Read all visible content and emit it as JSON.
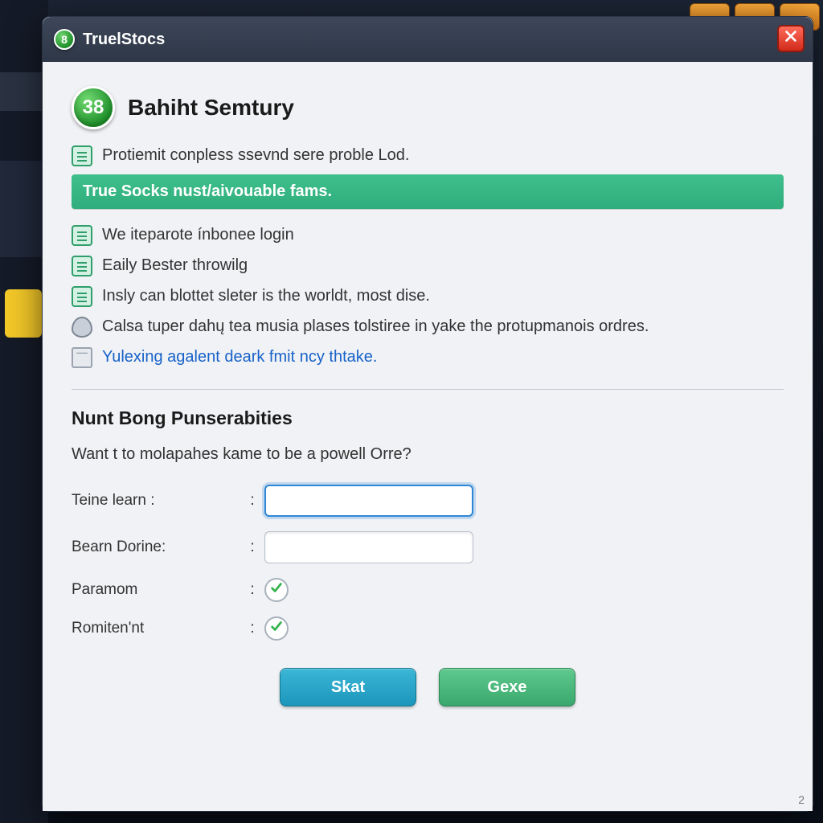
{
  "window": {
    "title": "TruelStocs",
    "title_badge": "8"
  },
  "header": {
    "badge_number": "38",
    "title": "Bahiht Semtury"
  },
  "intro_line": "Protiemit conpless ssevnd sere proble Lod.",
  "banner": "True Socks nust/aivouable fams.",
  "bullets": [
    "We iteparote ínbonee login",
    "Eaily Bester throwilg",
    "Insly can blottet sleter is the worldt, most dise.",
    "Calsa tuper dahų tea musia plases tolstiree in yake the protupmanois ordres."
  ],
  "link_line": "Yulexing agalent deark fmit ncy thtake.",
  "section": {
    "heading": "Nunt Bong Punserabities",
    "prompt": "Want t to molapahes kame to be a powell Orre?"
  },
  "form": {
    "field1_label": "Teine learn :",
    "field1_value": "",
    "field2_label": "Bearn Dorine:",
    "field2_value": "",
    "check1_label": "Paramom",
    "check1_checked": true,
    "check2_label": "Romiten'nt",
    "check2_checked": true
  },
  "buttons": {
    "primary": "Skat",
    "secondary": "Gexe"
  },
  "page_number": "2",
  "colors": {
    "accent_green": "#35b07c",
    "accent_blue": "#2aa0c4",
    "link": "#1862c9"
  }
}
